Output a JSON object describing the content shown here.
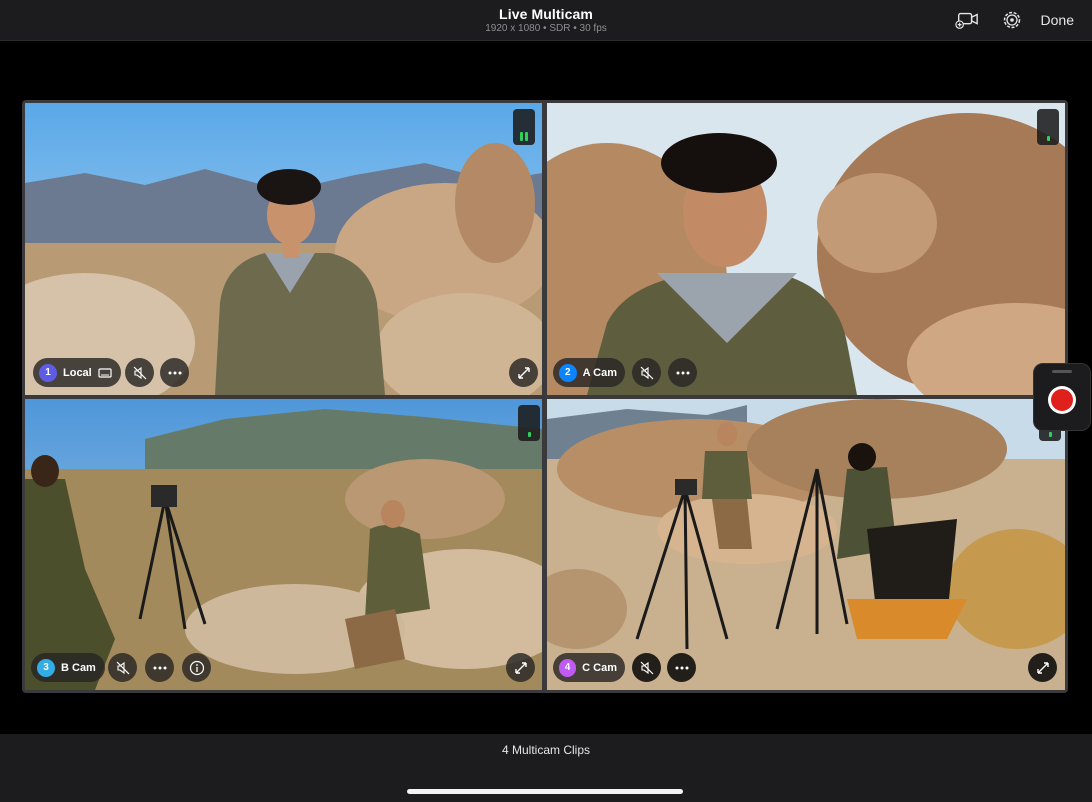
{
  "header": {
    "title": "Live Multicam",
    "subtitle": "1920 x 1080 • SDR • 30 fps",
    "add_camera_icon": "camera-plus-icon",
    "settings_icon": "gear-icon",
    "done_label": "Done"
  },
  "cameras": [
    {
      "number": "1",
      "name": "Local",
      "badge_color": "#5e5ce6",
      "muted": true,
      "has_screen_icon": true,
      "meter_level": 0.6
    },
    {
      "number": "2",
      "name": "A Cam",
      "badge_color": "#0a84ff",
      "muted": true,
      "meter_level": 0.3
    },
    {
      "number": "3",
      "name": "B Cam",
      "badge_color": "#32ade6",
      "muted": true,
      "has_info": true,
      "meter_level": 0.3
    },
    {
      "number": "4",
      "name": "C Cam",
      "badge_color": "#bf5af2",
      "muted": true,
      "meter_level": 0.3
    }
  ],
  "record": {
    "color": "#e0201c"
  },
  "footer": {
    "clip_count": "4 Multicam Clips"
  }
}
